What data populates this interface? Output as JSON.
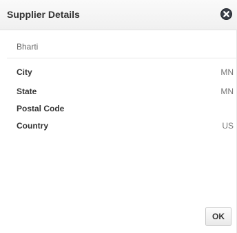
{
  "dialog": {
    "title": "Supplier Details",
    "close_icon": "close-icon"
  },
  "supplier": {
    "name": "Bharti"
  },
  "fields": [
    {
      "label": "City",
      "value": "MN"
    },
    {
      "label": "State",
      "value": "MN"
    },
    {
      "label": "Postal Code",
      "value": ""
    },
    {
      "label": "Country",
      "value": "US"
    }
  ],
  "footer": {
    "ok_label": "OK"
  },
  "colors": {
    "close_icon_bg": "#3a3f49",
    "title_text": "#333333",
    "value_text": "#777777"
  }
}
